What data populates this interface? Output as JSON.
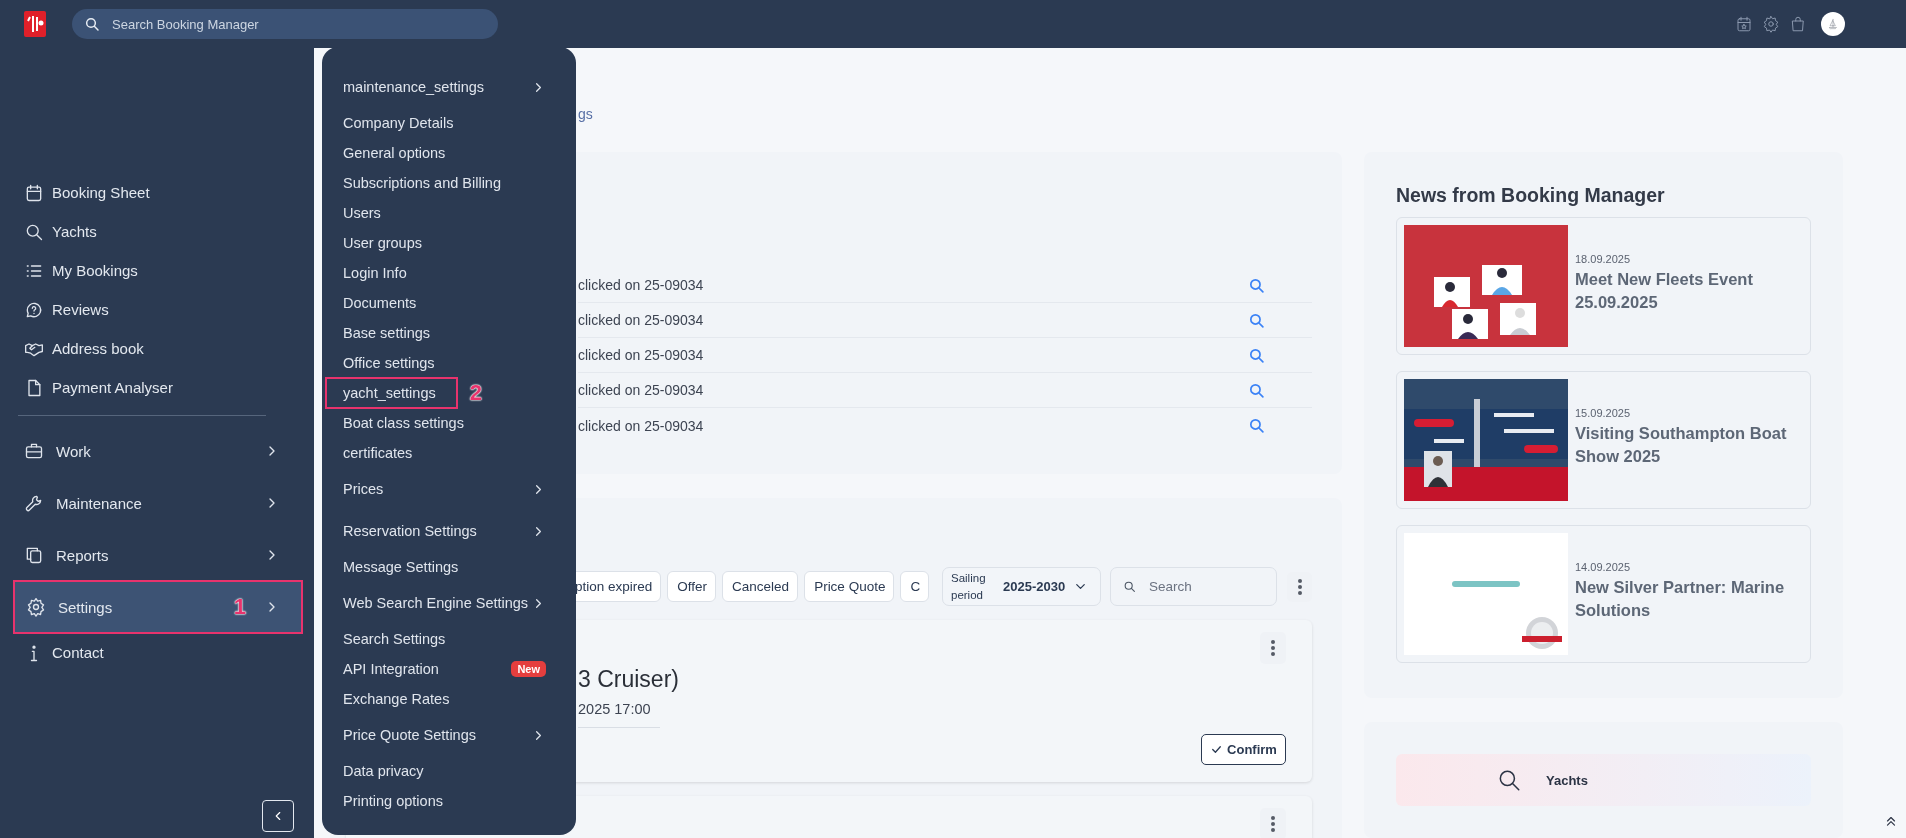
{
  "topbar": {
    "search": {
      "placeholder": "Search Booking Manager"
    }
  },
  "sidebar": {
    "items": [
      {
        "label": "Booking Sheet",
        "kind": "link",
        "selected": false
      },
      {
        "label": "Yachts",
        "kind": "link",
        "selected": false
      },
      {
        "label": "My Bookings",
        "kind": "link",
        "selected": false
      },
      {
        "label": "Reviews",
        "kind": "link",
        "selected": false
      },
      {
        "label": "Address book",
        "kind": "link",
        "selected": false
      },
      {
        "label": "Payment Analyser",
        "kind": "link",
        "selected": false
      },
      {
        "label": "Work",
        "kind": "group",
        "selected": false
      },
      {
        "label": "Maintenance",
        "kind": "group",
        "selected": false
      },
      {
        "label": "Reports",
        "kind": "group",
        "selected": false
      },
      {
        "label": "Settings",
        "kind": "group",
        "selected": true,
        "annotation": "1"
      },
      {
        "label": "Contact",
        "kind": "link",
        "selected": false
      }
    ]
  },
  "settings_menu": {
    "items": [
      {
        "label": "maintenance_settings",
        "submenu": true
      },
      {
        "label": "Company Details",
        "submenu": false
      },
      {
        "label": "General options",
        "submenu": false
      },
      {
        "label": "Subscriptions and Billing",
        "submenu": false
      },
      {
        "label": "Users",
        "submenu": false
      },
      {
        "label": "User groups",
        "submenu": false
      },
      {
        "label": "Login Info",
        "submenu": false
      },
      {
        "label": "Documents",
        "submenu": false
      },
      {
        "label": "Base settings",
        "submenu": false
      },
      {
        "label": "Office settings",
        "submenu": false
      },
      {
        "label": "yacht_settings",
        "submenu": false,
        "annotation": "2"
      },
      {
        "label": "Boat class settings",
        "submenu": false
      },
      {
        "label": "certificates",
        "submenu": false
      },
      {
        "label": "Prices",
        "submenu": true
      },
      {
        "label": "Reservation Settings",
        "submenu": true
      },
      {
        "label": "Message Settings",
        "submenu": false
      },
      {
        "label": "Web Search Engine Settings",
        "submenu": true
      },
      {
        "label": "Search Settings",
        "submenu": false
      },
      {
        "label": "API Integration",
        "submenu": false,
        "badge": "New"
      },
      {
        "label": "Exchange Rates",
        "submenu": false
      },
      {
        "label": "Price Quote Settings",
        "submenu": true
      },
      {
        "label": "Data privacy",
        "submenu": false
      },
      {
        "label": "Printing options",
        "submenu": false
      }
    ]
  },
  "main": {
    "breadcrumb": "gs",
    "activity": {
      "rows": [
        {
          "text": "clicked on 25-09034"
        },
        {
          "text": "clicked on 25-09034"
        },
        {
          "text": "clicked on 25-09034"
        },
        {
          "text": "clicked on 25-09034"
        },
        {
          "text": "clicked on 25-09034"
        }
      ]
    },
    "bookings": {
      "filters": [
        {
          "label": "ption expired",
          "selected": false
        },
        {
          "label": "Offer",
          "selected": false
        },
        {
          "label": "Canceled",
          "selected": false
        },
        {
          "label": "Price Quote",
          "selected": false
        },
        {
          "label": "C",
          "selected": false
        }
      ],
      "sailing_period": {
        "label": "Sailing period",
        "value": "2025-2030"
      },
      "search": {
        "placeholder": "Search"
      },
      "cards": [
        {
          "kind": "full",
          "title": "3 Cruiser)",
          "time": "2025 17:00",
          "action": "Confirm"
        },
        {
          "kind": "cut"
        }
      ]
    }
  },
  "news": {
    "title": "News from Booking Manager",
    "items": [
      {
        "date": "18.09.2025",
        "headline": "Meet New Fleets Event 25.09.2025"
      },
      {
        "date": "15.09.2025",
        "headline": "Visiting Southampton Boat Show 2025"
      },
      {
        "date": "14.09.2025",
        "headline": "New Silver Partner: Marine Solutions"
      }
    ]
  },
  "quick_links": {
    "items": [
      {
        "label": "Yachts"
      }
    ]
  }
}
